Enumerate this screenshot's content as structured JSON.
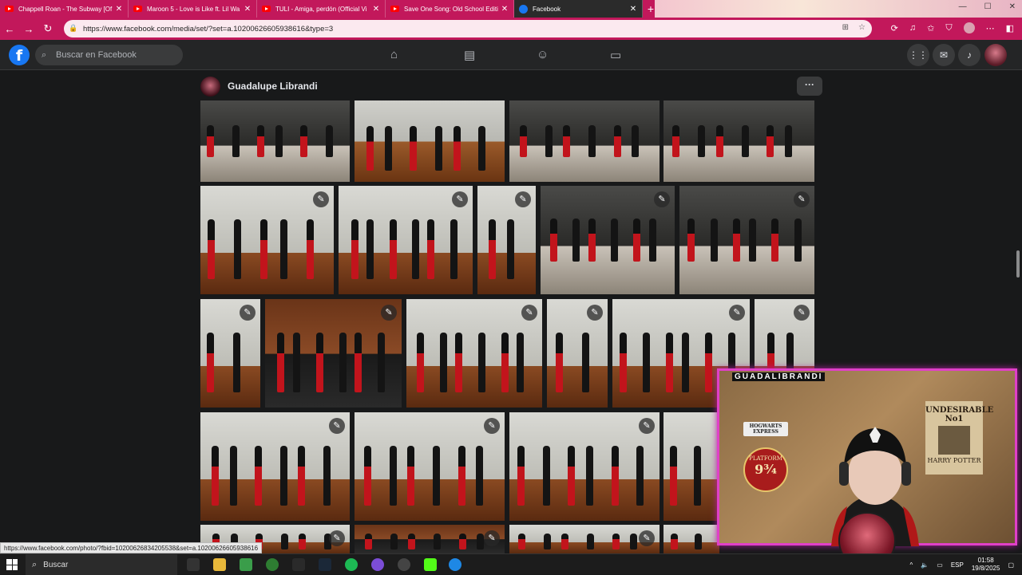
{
  "browser": {
    "tabs": [
      {
        "title": "Chappell Roan - The Subway [Of",
        "icon": "youtube-icon"
      },
      {
        "title": "Maroon 5 - Love is Like ft. Lil Wa",
        "icon": "youtube-icon"
      },
      {
        "title": "TULI - Amiga, perdón (Official Vi",
        "icon": "youtube-icon"
      },
      {
        "title": "Save One Song: Old School Editi",
        "icon": "youtube-icon"
      },
      {
        "title": "Facebook",
        "icon": "facebook-icon",
        "active": true
      }
    ],
    "url": "https://www.facebook.com/media/set/?set=a.10200626605938616&type=3"
  },
  "facebook": {
    "search_placeholder": "Buscar en Facebook",
    "album_owner": "Guadalupe Librandi",
    "more_label": "···"
  },
  "status_bar_link": "https://www.facebook.com/photo/?fbid=10200626834205538&set=a.10200626605938616",
  "webcam": {
    "label": "GUADALIBRANDI",
    "poster_line1": "UNDESIRABLE",
    "poster_line2": "No1",
    "poster_line3": "HARRY POTTER",
    "hogwarts_sign": "HOGWARTS EXPRESS",
    "platform_text": "PLATFORM",
    "platform_number": "9¾"
  },
  "taskbar": {
    "search_label": "Buscar",
    "language": "ESP",
    "time": "01:58",
    "date": "19/8/2025"
  },
  "colors": {
    "browser_accent": "#c2185b",
    "facebook_blue": "#1877f2",
    "facebook_bg": "#18191a",
    "webcam_border": "#e040c8"
  }
}
